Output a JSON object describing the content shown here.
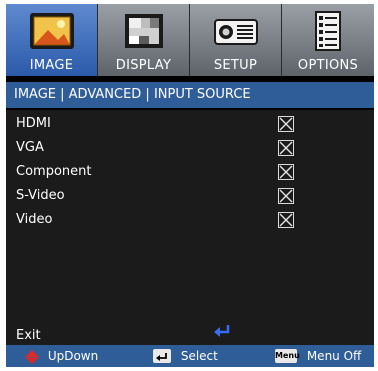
{
  "tabs": [
    {
      "label": "IMAGE",
      "icon": "image-icon",
      "active": true
    },
    {
      "label": "DISPLAY",
      "icon": "display-icon",
      "active": false
    },
    {
      "label": "SETUP",
      "icon": "setup-icon",
      "active": false
    },
    {
      "label": "OPTIONS",
      "icon": "options-icon",
      "active": false
    }
  ],
  "header": {
    "title": "IMAGE | ADVANCED | INPUT SOURCE"
  },
  "items": [
    {
      "label": "HDMI",
      "checked": true
    },
    {
      "label": "VGA",
      "checked": true
    },
    {
      "label": "Component",
      "checked": true
    },
    {
      "label": "S-Video",
      "checked": true
    },
    {
      "label": "Video",
      "checked": true
    }
  ],
  "exit": {
    "label": "Exit"
  },
  "footer": {
    "updown_label": "UpDown",
    "select_label": "Select",
    "menu_key": "Menu",
    "menu_off_label": "Menu Off"
  },
  "colors": {
    "active_tab": "#3b6fc0",
    "header_bar": "#2f5d98",
    "footer_bar": "#2f5d98",
    "updown_arrow": "#d92b2b",
    "enter_arrow": "#3a6cf0"
  }
}
